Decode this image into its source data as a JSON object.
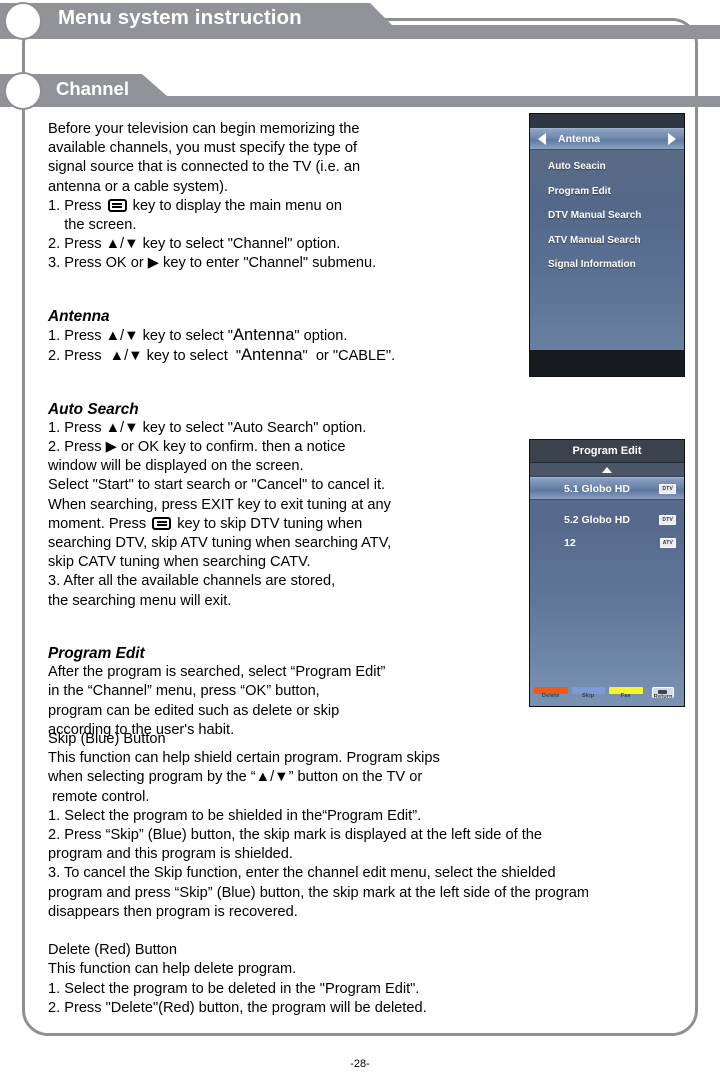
{
  "header": {
    "main_title": "Menu system instruction",
    "sub_title": "Channel"
  },
  "body": {
    "intro": "Before your television can begin memorizing the\navailable channels, you must specify the type of\nsignal source that is connected to the TV (i.e. an\nantenna or a cable system).",
    "step1_pre": "1. Press ",
    "step1_post": " key to display the main menu on\n    the screen.",
    "step2": "2. Press ▲/▼ key to select \"Channel\" option.",
    "step3": "3. Press OK or ▶ key to enter \"Channel\" submenu.",
    "antenna_title": "Antenna",
    "antenna_1a": "1. Press ▲/▼ key to select \"",
    "antenna_1b": "Antenna",
    "antenna_1c": "\" option.",
    "antenna_2a": "2. Press  ▲/▼ key to select  \"",
    "antenna_2b": "Antenna",
    "antenna_2c": "\"  or \"CABLE\".",
    "autosearch_title": "Auto Search",
    "autosearch_1": "1. Press ▲/▼ key to select \"Auto Search\" option.",
    "autosearch_2": "2. Press ▶ or OK key to confirm. then a notice\nwindow will be displayed on the screen.\nSelect \"Start\" to start search or \"Cancel\" to cancel it.\nWhen searching, press EXIT key to exit tuning at any\nmoment. Press ",
    "autosearch_2b": " key to skip DTV tuning when\nsearching DTV, skip ATV tuning when searching ATV,\nskip CATV tuning when searching CATV.",
    "autosearch_3": "3. After all the available channels are stored,\nthe searching menu will exit.",
    "progedit_title": "Program Edit",
    "progedit_body": "After the program is searched, select “Program Edit”\nin the “Channel” menu, press “OK” button,\nprogram can be edited such as delete or skip\naccording to the user's habit.",
    "lower": "Skip (Blue) Button\nThis function can help shield certain program. Program skips\nwhen selecting program by the “▲/▼” button on the TV or\n remote control.\n1. Select the program to be shielded in the“Program Edit”.\n2. Press “Skip” (Blue) button, the skip mark is displayed at the left side of the\nprogram and this program is shielded.\n3. To cancel the Skip function, enter the channel edit menu, select the shielded\nprogram and press “Skip” (Blue) button, the skip mark at the left side of the program\ndisappears then program is recovered.\n\nDelete (Red) Button\nThis function can help delete program.\n1. Select the program to be deleted in the \"Program Edit\".\n2. Press \"Delete\"(Red) button, the program will be deleted."
  },
  "osd_antenna": {
    "selected_label": "Antenna",
    "items": [
      "Auto Seacin",
      "Program Edit",
      "DTV Manual Search",
      "ATV Manual Search",
      "Signal Information"
    ]
  },
  "osd_program_edit": {
    "title": "Program Edit",
    "rows": [
      {
        "name": "5.1 Globo HD",
        "badge": "DTV"
      },
      {
        "name": "5.2 Globo HD",
        "badge": "DTV"
      },
      {
        "name": "12",
        "badge": "ATV"
      }
    ],
    "color_buttons": [
      {
        "label": "Delete",
        "color": "#ed5a1b"
      },
      {
        "label": "Skip",
        "color": "#7e9ad4"
      },
      {
        "label": "Fav",
        "color": "#f5f52a"
      },
      {
        "label": "Return",
        "color": "#d5dbe3"
      }
    ]
  },
  "footer": {
    "page_number": "-28-"
  },
  "colors": {
    "header_gray": "#919398",
    "frame_gray": "#8d8f92",
    "osd_blue": "#5f7698",
    "osd_highlight": "#6d86ac",
    "osd_dark": "#2f3742"
  }
}
